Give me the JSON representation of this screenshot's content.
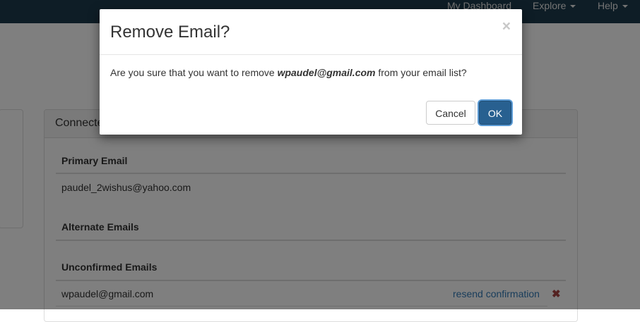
{
  "navbar": {
    "dashboard_label": "My Dashboard",
    "explore_label": "Explore",
    "help_label": "Help"
  },
  "panel": {
    "title": "Connected Emails",
    "primary_heading": "Primary Email",
    "primary_email": "paudel_2wishus@yahoo.com",
    "alternate_heading": "Alternate Emails",
    "unconfirmed_heading": "Unconfirmed Emails",
    "unconfirmed": [
      {
        "email": "wpaudel@gmail.com",
        "action": "resend confirmation",
        "remove_icon": "✖"
      }
    ]
  },
  "modal": {
    "title": "Remove Email?",
    "close_glyph": "×",
    "message_before": "Are you sure that you want to remove ",
    "message_email": "wpaudel@gmail.com",
    "message_after": " from your email list?",
    "cancel_label": "Cancel",
    "ok_label": "OK"
  },
  "colors": {
    "navbar": "#1d3b4d",
    "primary_button": "#286090",
    "link": "#337ab7",
    "danger": "#a94442"
  }
}
